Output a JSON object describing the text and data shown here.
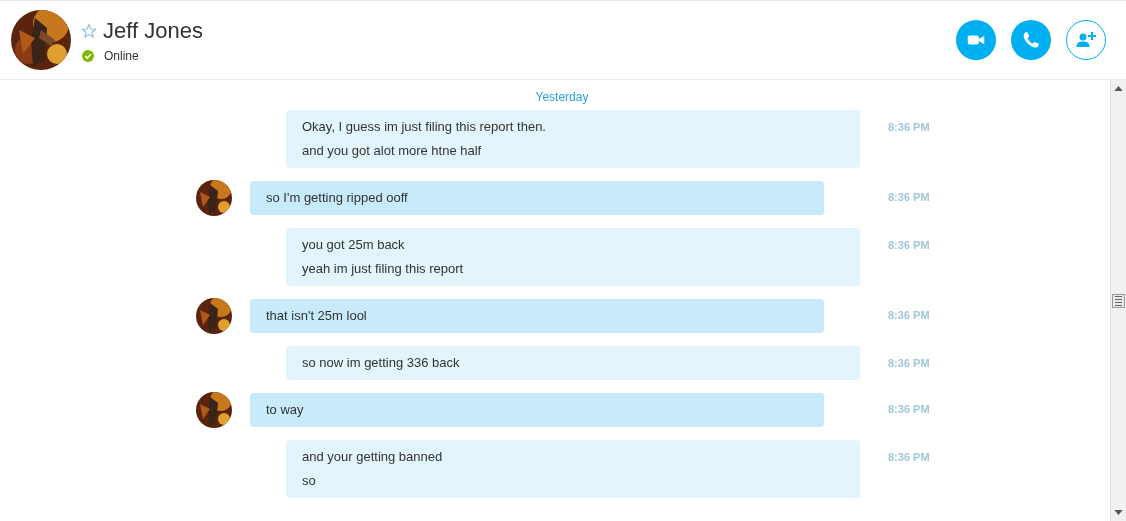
{
  "contact": {
    "name": "Jeff Jones",
    "favorite": false,
    "status": "Online",
    "online": true
  },
  "actions": [
    {
      "kind": "video"
    },
    {
      "kind": "call"
    },
    {
      "kind": "add-person"
    }
  ],
  "date_divider": "Yesterday",
  "messages": [
    {
      "kind": "outgoing",
      "lines": [
        "Okay, I guess im just filing this report then.",
        "and you got alot more htne half"
      ],
      "time": "8:36 PM"
    },
    {
      "kind": "incoming",
      "lines": [
        "so I'm getting ripped ooff"
      ],
      "time": "8:36 PM"
    },
    {
      "kind": "outgoing",
      "lines": [
        "you got 25m back",
        "yeah im just filing this report"
      ],
      "time": "8:36 PM"
    },
    {
      "kind": "incoming",
      "lines": [
        "that isn't 25m lool"
      ],
      "time": "8:36 PM"
    },
    {
      "kind": "outgoing",
      "lines": [
        "so now im getting 336 back"
      ],
      "time": "8:36 PM"
    },
    {
      "kind": "incoming",
      "lines": [
        "to way"
      ],
      "time": "8:36 PM"
    },
    {
      "kind": "outgoing",
      "lines": [
        "and your getting banned",
        "so"
      ],
      "time": "8:36 PM"
    }
  ]
}
